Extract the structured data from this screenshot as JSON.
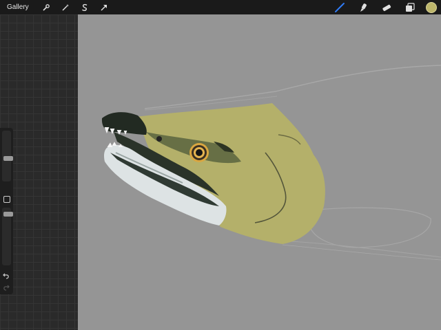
{
  "toolbar": {
    "gallery_label": "Gallery",
    "left_tools": [
      "wrench-icon",
      "magic-wand-icon",
      "selection-s-icon",
      "transform-arrow-icon"
    ],
    "right_tools": [
      "brush-icon",
      "smudge-icon",
      "eraser-icon",
      "layers-icon"
    ],
    "active_tool": "brush",
    "accent_color": "#2f7bf5",
    "current_color": "#bdb66b"
  },
  "sidebar": {
    "brush_size_level": 0.55,
    "opacity_level": 0.9
  },
  "canvas": {
    "background": "#959595",
    "fish_head_color": "#b4b06a"
  }
}
